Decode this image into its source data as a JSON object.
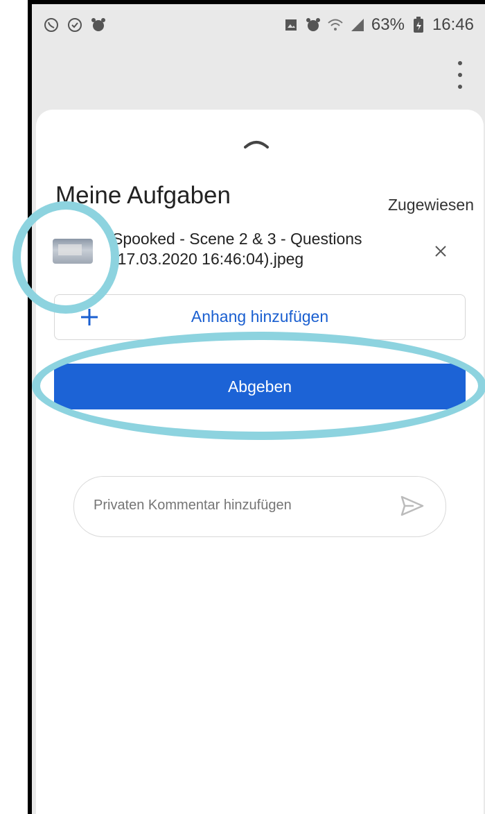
{
  "status_bar": {
    "battery_percent": "63%",
    "time": "16:46",
    "left_icons": [
      "whatsapp-icon",
      "check-circle-icon",
      "alarm-icon"
    ],
    "right_icons": [
      "image-icon",
      "alarm-icon",
      "wifi-icon",
      "signal-icon",
      "battery-icon"
    ]
  },
  "sheet": {
    "title": "Meine Aufgaben",
    "status": "Zugewiesen",
    "attachment": {
      "name": "Spooked - Scene 2 & 3 - Questions (17.03.2020 16:46:04).jpeg"
    },
    "add_attachment_label": "Anhang hinzufügen",
    "submit_label": "Abgeben",
    "comment_placeholder": "Privaten Kommentar hinzufügen"
  },
  "colors": {
    "accent": "#1c63d6",
    "annotation": "#8dd3df"
  }
}
